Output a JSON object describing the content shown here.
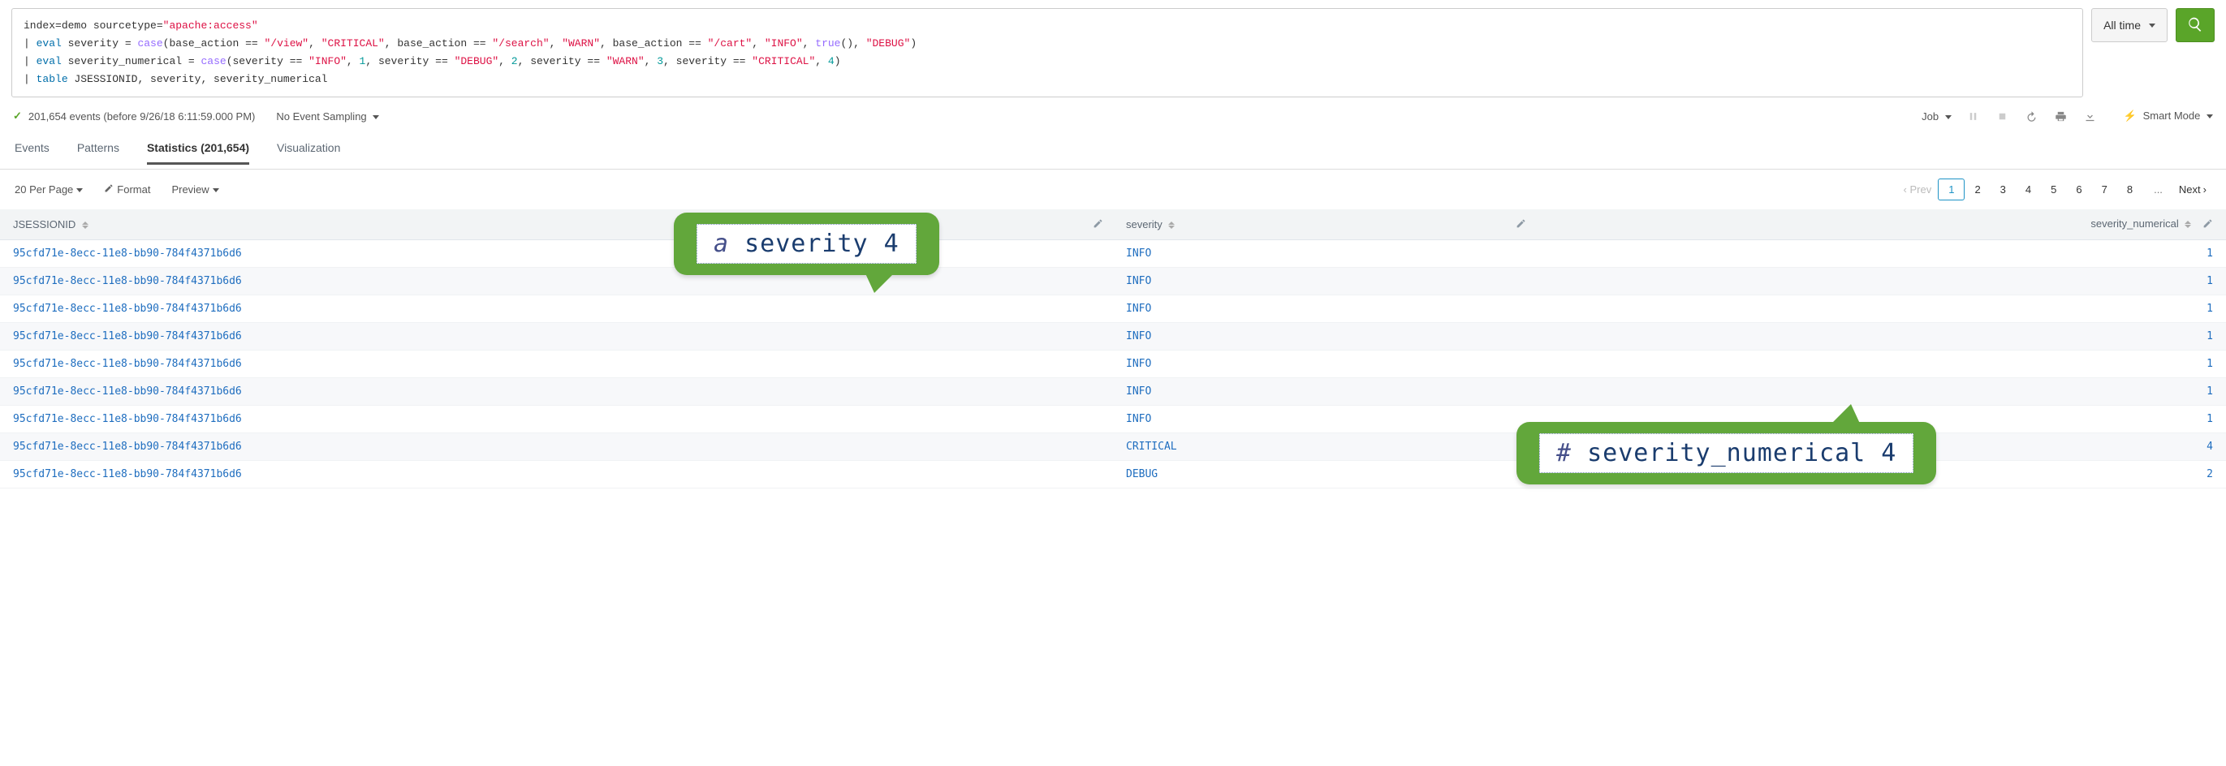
{
  "search": {
    "lines": [
      {
        "pre": "",
        "tokens": [
          {
            "t": "index",
            "c": "plain"
          },
          {
            "t": "=demo sourcetype=",
            "c": "plain"
          },
          {
            "t": "\"apache:access\"",
            "c": "str"
          }
        ]
      },
      {
        "pre": "| ",
        "tokens": [
          {
            "t": "eval",
            "c": "kw-blue"
          },
          {
            "t": " severity = ",
            "c": "plain"
          },
          {
            "t": "case",
            "c": "kw-purple"
          },
          {
            "t": "(base_action == ",
            "c": "plain"
          },
          {
            "t": "\"/view\"",
            "c": "str"
          },
          {
            "t": ", ",
            "c": "plain"
          },
          {
            "t": "\"CRITICAL\"",
            "c": "str"
          },
          {
            "t": ", base_action == ",
            "c": "plain"
          },
          {
            "t": "\"/search\"",
            "c": "str"
          },
          {
            "t": ", ",
            "c": "plain"
          },
          {
            "t": "\"WARN\"",
            "c": "str"
          },
          {
            "t": ", base_action == ",
            "c": "plain"
          },
          {
            "t": "\"/cart\"",
            "c": "str"
          },
          {
            "t": ", ",
            "c": "plain"
          },
          {
            "t": "\"INFO\"",
            "c": "str"
          },
          {
            "t": ", ",
            "c": "plain"
          },
          {
            "t": "true",
            "c": "kw-purple"
          },
          {
            "t": "(), ",
            "c": "plain"
          },
          {
            "t": "\"DEBUG\"",
            "c": "str"
          },
          {
            "t": ")",
            "c": "plain"
          }
        ]
      },
      {
        "pre": "| ",
        "tokens": [
          {
            "t": "eval",
            "c": "kw-blue"
          },
          {
            "t": " severity_numerical = ",
            "c": "plain"
          },
          {
            "t": "case",
            "c": "kw-purple"
          },
          {
            "t": "(severity == ",
            "c": "plain"
          },
          {
            "t": "\"INFO\"",
            "c": "str"
          },
          {
            "t": ", ",
            "c": "plain"
          },
          {
            "t": "1",
            "c": "num"
          },
          {
            "t": ", severity == ",
            "c": "plain"
          },
          {
            "t": "\"DEBUG\"",
            "c": "str"
          },
          {
            "t": ", ",
            "c": "plain"
          },
          {
            "t": "2",
            "c": "num"
          },
          {
            "t": ", severity == ",
            "c": "plain"
          },
          {
            "t": "\"WARN\"",
            "c": "str"
          },
          {
            "t": ", ",
            "c": "plain"
          },
          {
            "t": "3",
            "c": "num"
          },
          {
            "t": ", severity == ",
            "c": "plain"
          },
          {
            "t": "\"CRITICAL\"",
            "c": "str"
          },
          {
            "t": ", ",
            "c": "plain"
          },
          {
            "t": "4",
            "c": "num"
          },
          {
            "t": ")",
            "c": "plain"
          }
        ]
      },
      {
        "pre": "| ",
        "tokens": [
          {
            "t": "table",
            "c": "kw-blue"
          },
          {
            "t": " JSESSIONID, severity, severity_numerical",
            "c": "plain"
          }
        ]
      }
    ]
  },
  "time_range": "All time",
  "status": {
    "events_text": "201,654 events (before 9/26/18 6:11:59.000 PM)",
    "sampling_label": "No Event Sampling",
    "job_label": "Job",
    "smart_mode_label": "Smart Mode"
  },
  "tabs": {
    "events": "Events",
    "patterns": "Patterns",
    "statistics": "Statistics (201,654)",
    "visualization": "Visualization"
  },
  "table_ctrl": {
    "per_page": "20 Per Page",
    "format": "Format",
    "preview": "Preview"
  },
  "pager": {
    "prev": "Prev",
    "pages": [
      "1",
      "2",
      "3",
      "4",
      "5",
      "6",
      "7",
      "8"
    ],
    "ellipsis": "...",
    "next": "Next"
  },
  "columns": {
    "jsessionid": "JSESSIONID",
    "severity": "severity",
    "severity_numerical": "severity_numerical"
  },
  "rows": [
    {
      "j": "95cfd71e-8ecc-11e8-bb90-784f4371b6d6",
      "s": "INFO",
      "n": "1"
    },
    {
      "j": "95cfd71e-8ecc-11e8-bb90-784f4371b6d6",
      "s": "INFO",
      "n": "1"
    },
    {
      "j": "95cfd71e-8ecc-11e8-bb90-784f4371b6d6",
      "s": "INFO",
      "n": "1"
    },
    {
      "j": "95cfd71e-8ecc-11e8-bb90-784f4371b6d6",
      "s": "INFO",
      "n": "1"
    },
    {
      "j": "95cfd71e-8ecc-11e8-bb90-784f4371b6d6",
      "s": "INFO",
      "n": "1"
    },
    {
      "j": "95cfd71e-8ecc-11e8-bb90-784f4371b6d6",
      "s": "INFO",
      "n": "1"
    },
    {
      "j": "95cfd71e-8ecc-11e8-bb90-784f4371b6d6",
      "s": "INFO",
      "n": "1"
    },
    {
      "j": "95cfd71e-8ecc-11e8-bb90-784f4371b6d6",
      "s": "CRITICAL",
      "n": "4"
    },
    {
      "j": "95cfd71e-8ecc-11e8-bb90-784f4371b6d6",
      "s": "DEBUG",
      "n": "2"
    }
  ],
  "callouts": {
    "c1": {
      "lead": "a ",
      "text": "severity 4"
    },
    "c2": {
      "lead": "# ",
      "text": "severity_numerical 4"
    }
  }
}
